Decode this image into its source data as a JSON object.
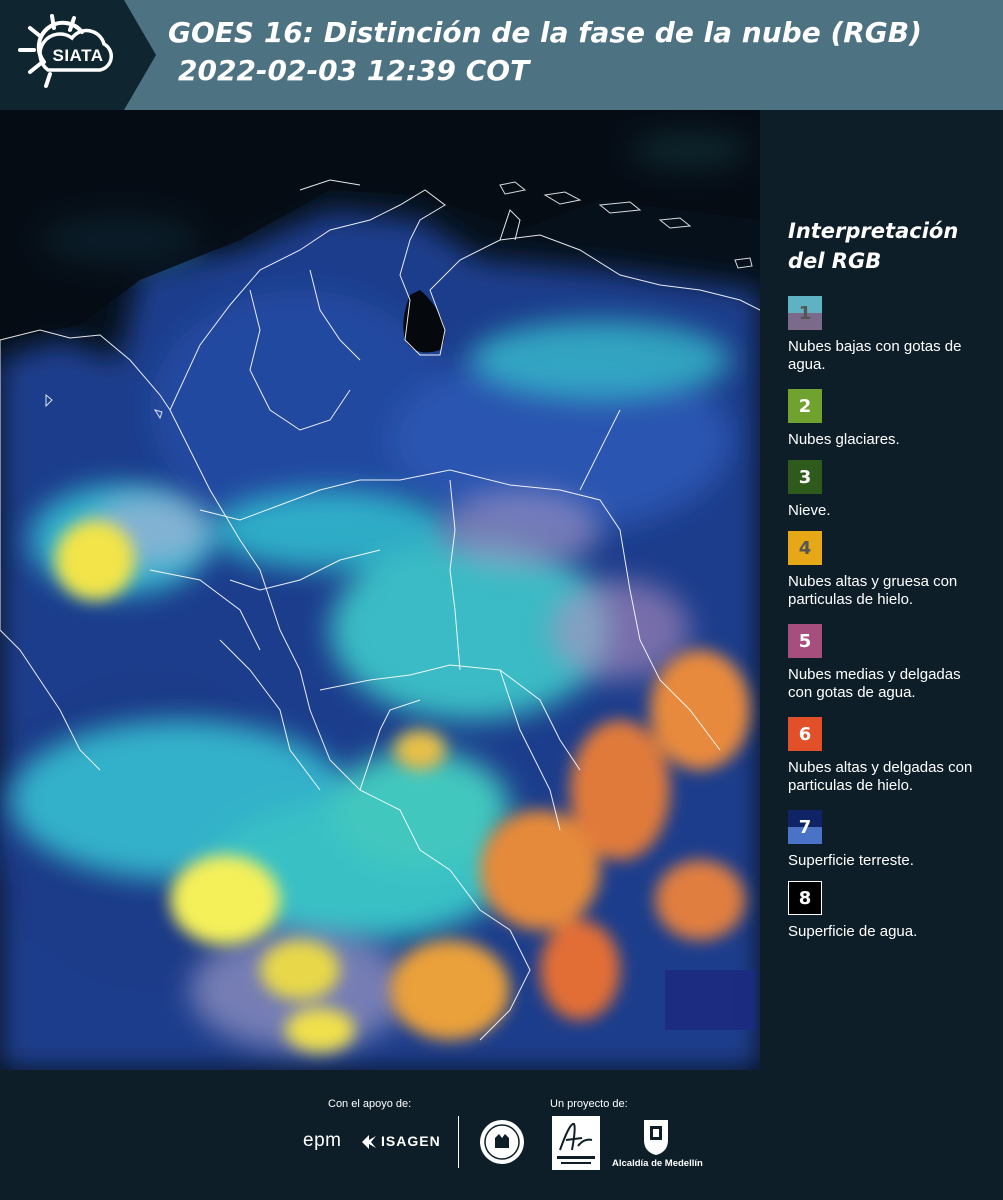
{
  "header": {
    "logo_text": "SIATA",
    "title_line1": "GOES 16: Distinción de la fase de la nube (RGB)",
    "title_line2": "2022-02-03 12:39 COT"
  },
  "legend": {
    "title_line1": "Interpretación",
    "title_line2": "del RGB",
    "items": [
      {
        "num": "1",
        "label": "Nubes bajas con gotas de agua.",
        "color_top": "#5fb2c2",
        "color_bottom": "#7c6a8a",
        "num_color": "#555555"
      },
      {
        "num": "2",
        "label": "Nubes glaciares.",
        "color_top": "#6fa22f",
        "color_bottom": "#6fa22f",
        "num_color": "#ffffff"
      },
      {
        "num": "3",
        "label": "Nieve.",
        "color_top": "#2e5a1c",
        "color_bottom": "#2e5a1c",
        "num_color": "#ffffff"
      },
      {
        "num": "4",
        "label": "Nubes altas y gruesa con particulas de hielo.",
        "color_top": "#e6a816",
        "color_bottom": "#e6a816",
        "num_color": "#555555"
      },
      {
        "num": "5",
        "label": "Nubes medias y delgadas con gotas de agua.",
        "color_top": "#a64f7e",
        "color_bottom": "#a64f7e",
        "num_color": "#ffffff"
      },
      {
        "num": "6",
        "label": "Nubes altas y delgadas con particulas de hielo.",
        "color_top": "#e2502a",
        "color_bottom": "#e2502a",
        "num_color": "#ffffff"
      },
      {
        "num": "7",
        "label": "Superficie terreste.",
        "color_top": "#0e2466",
        "color_bottom": "#4a72c6",
        "num_color": "#ffffff"
      },
      {
        "num": "8",
        "label": "Superficie de agua.",
        "color_top": "#000000",
        "color_bottom": "#000000",
        "num_color": "#ffffff"
      }
    ]
  },
  "footer": {
    "support_label": "Con el apoyo de:",
    "project_label": "Un proyecto de:",
    "sponsor_epm": "epm",
    "sponsor_isagen": "ISAGEN",
    "org_alcaldia": "Alcaldía de Medellín"
  },
  "colors": {
    "header_bg": "#4d7282",
    "logo_bg": "#0f2530",
    "panel_bg": "#0e1e28"
  }
}
